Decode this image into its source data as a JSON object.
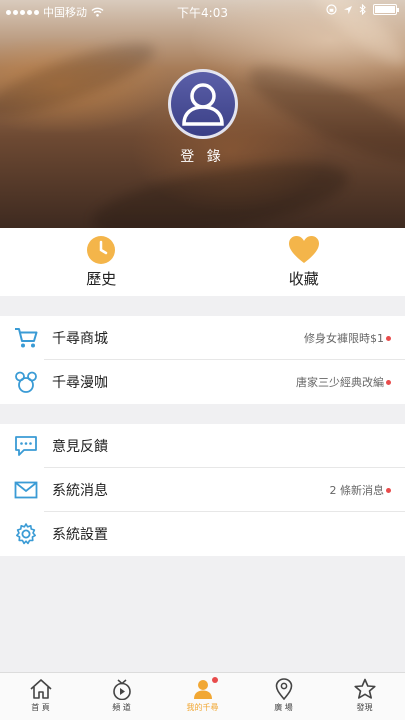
{
  "status_bar": {
    "carrier": "中国移动",
    "time": "下午4:03"
  },
  "profile": {
    "login_label": "登 錄"
  },
  "quick_actions": [
    {
      "label": "歷史",
      "icon": "clock-icon"
    },
    {
      "label": "收藏",
      "icon": "heart-icon"
    }
  ],
  "menu_group_1": [
    {
      "label": "千尋商城",
      "right": "修身女褲限時$1",
      "icon": "cart-icon",
      "dot": true
    },
    {
      "label": "千尋漫咖",
      "right": "唐家三少經典改編",
      "icon": "mickey-icon",
      "dot": true
    }
  ],
  "menu_group_2": [
    {
      "label": "意見反饋",
      "right": "",
      "icon": "chat-bubble-icon"
    },
    {
      "label": "系統消息",
      "right": "2 條新消息",
      "icon": "envelope-icon",
      "dot": true
    },
    {
      "label": "系統設置",
      "right": "",
      "icon": "gear-icon"
    }
  ],
  "tabbar": [
    {
      "label": "首 頁",
      "icon": "home-icon"
    },
    {
      "label": "頻 道",
      "icon": "tv-icon"
    },
    {
      "label": "我的千尋",
      "icon": "user-icon",
      "active": true,
      "badge": true
    },
    {
      "label": "廣 場",
      "icon": "location-pin-icon"
    },
    {
      "label": "發現",
      "icon": "star-icon"
    }
  ],
  "colors": {
    "accent": "#f1a733",
    "icon_blue": "#3a9bd5",
    "badge_red": "#e84b4b"
  }
}
